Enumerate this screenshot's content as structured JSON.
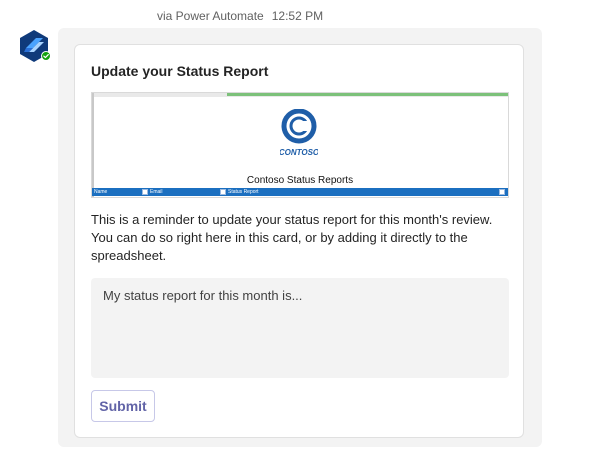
{
  "message": {
    "via": "via Power Automate",
    "time": "12:52 PM"
  },
  "avatar": {
    "icon": "power-automate-icon",
    "status_icon": "status-check-icon",
    "status_color": "#13a10e"
  },
  "card": {
    "title": "Update your Status Report",
    "image": {
      "logo_text": "CONTOSO",
      "sheet_title": "Contoso Status Reports",
      "columns": [
        "Name",
        "Email",
        "Status Report"
      ],
      "header_color": "#1b6fc0"
    },
    "body": "This is a reminder to update your status report for this month's review. You can do so right here in this card, or by adding it directly to the spreadsheet.",
    "input_placeholder": "My status report for this month is...",
    "submit_label": "Submit"
  },
  "colors": {
    "accent": "#6264a7",
    "bubble_bg": "#f3f3f3",
    "input_bg": "#f3f3f3"
  }
}
